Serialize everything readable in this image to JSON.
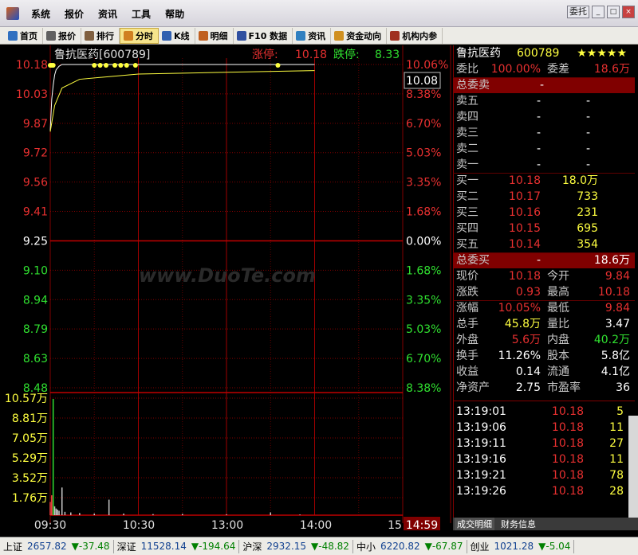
{
  "title_bar": {
    "menus": [
      "系统",
      "报价",
      "资讯",
      "工具",
      "帮助"
    ],
    "commission_btn": "委托",
    "min_btn": "_",
    "max_btn": "□",
    "close_btn": "×"
  },
  "toolbar": {
    "items": [
      {
        "label": "首页",
        "icon": "home-icon",
        "color": "#3070c0"
      },
      {
        "label": "报价",
        "icon": "quote-table-icon",
        "color": "#606060"
      },
      {
        "label": "排行",
        "icon": "rank-icon",
        "color": "#806040"
      },
      {
        "label": "分时",
        "icon": "timeshare-icon",
        "color": "#d08020",
        "active": true
      },
      {
        "label": "K线",
        "icon": "kline-icon",
        "color": "#3060b0"
      },
      {
        "label": "明细",
        "icon": "detail-icon",
        "color": "#c06020"
      },
      {
        "label": "F10 数据",
        "icon": "f10-icon",
        "color": "#3050a0"
      },
      {
        "label": "资讯",
        "icon": "news-icon",
        "color": "#3080c0"
      },
      {
        "label": "资金动向",
        "icon": "money-flow-icon",
        "color": "#d09020"
      },
      {
        "label": "机构内参",
        "icon": "institution-icon",
        "color": "#a03020"
      }
    ]
  },
  "chart_header": {
    "stock": "鲁抗医药[600789]",
    "limit_up_label": "涨停:",
    "limit_up": "10.18",
    "limit_down_label": "跌停:",
    "limit_down": "8.33",
    "watermark": "www.DuoTe.com"
  },
  "price_axis": {
    "left": [
      "10.18",
      "10.03",
      "9.87",
      "9.72",
      "9.56",
      "9.41",
      "9.25",
      "9.10",
      "8.94",
      "8.79",
      "8.63",
      "8.48"
    ],
    "right": [
      "10.06%",
      "8.38%",
      "6.70%",
      "5.03%",
      "3.35%",
      "1.68%",
      "0.00%",
      "1.68%",
      "3.35%",
      "5.03%",
      "6.70%",
      "8.38%"
    ],
    "current_price_tag": "10.08"
  },
  "volume_axis": [
    "10.57万",
    "8.81万",
    "7.05万",
    "5.29万",
    "3.52万",
    "1.76万"
  ],
  "time_axis": {
    "ticks": [
      "09:30",
      "10:30",
      "13:00",
      "14:00",
      "15"
    ],
    "current_time": "14:59"
  },
  "chart_data": {
    "type": "line",
    "title": "鲁抗医药[600789]",
    "price_ylim": [
      8.33,
      10.18
    ],
    "prev_close": 9.25,
    "price_series": [
      {
        "t": 0,
        "v": 9.8
      },
      {
        "t": 1,
        "v": 9.98
      },
      {
        "t": 2,
        "v": 10.06
      },
      {
        "t": 3,
        "v": 10.12
      },
      {
        "t": 4,
        "v": 10.15
      },
      {
        "t": 5,
        "v": 10.16
      },
      {
        "t": 6,
        "v": 10.17
      },
      {
        "t": 8,
        "v": 10.18
      },
      {
        "t": 12,
        "v": 10.18
      },
      {
        "t": 20,
        "v": 10.18
      },
      {
        "t": 30,
        "v": 10.18
      },
      {
        "t": 60,
        "v": 10.18
      },
      {
        "t": 90,
        "v": 10.18
      },
      {
        "t": 120,
        "v": 10.18
      },
      {
        "t": 150,
        "v": 10.18
      },
      {
        "t": 180,
        "v": 10.18
      }
    ],
    "avg_series": [
      {
        "t": 0,
        "v": 9.8
      },
      {
        "t": 3,
        "v": 9.95
      },
      {
        "t": 8,
        "v": 10.05
      },
      {
        "t": 20,
        "v": 10.1
      },
      {
        "t": 60,
        "v": 10.13
      },
      {
        "t": 120,
        "v": 10.14
      },
      {
        "t": 180,
        "v": 10.15
      }
    ],
    "volume_ylim": [
      0,
      105700
    ],
    "volume": [
      {
        "t": 0,
        "v": 12000
      },
      {
        "t": 1,
        "v": 18000
      },
      {
        "t": 2,
        "v": 105000
      },
      {
        "t": 3,
        "v": 8000
      },
      {
        "t": 4,
        "v": 6000
      },
      {
        "t": 5,
        "v": 5000
      },
      {
        "t": 6,
        "v": 4000
      },
      {
        "t": 8,
        "v": 25000
      },
      {
        "t": 10,
        "v": 3000
      },
      {
        "t": 14,
        "v": 2500
      },
      {
        "t": 20,
        "v": 2000
      },
      {
        "t": 30,
        "v": 1500
      },
      {
        "t": 40,
        "v": 14000
      },
      {
        "t": 50,
        "v": 1500
      },
      {
        "t": 70,
        "v": 1000
      },
      {
        "t": 90,
        "v": 1200
      },
      {
        "t": 120,
        "v": 800
      },
      {
        "t": 150,
        "v": 2500
      },
      {
        "t": 170,
        "v": 600
      }
    ],
    "markers_t": [
      0,
      1,
      2,
      30,
      34,
      38,
      44,
      48,
      52,
      58,
      155
    ],
    "session_minutes": 240,
    "grid": true
  },
  "quote_panel": {
    "name": "鲁抗医药",
    "code": "600789",
    "stars": "★★★★★",
    "wei_bi_label": "委比",
    "wei_bi": "100.00%",
    "wei_cha_label": "委差",
    "wei_cha": "18.6万",
    "total_sell_label": "总委卖",
    "total_sell": "-",
    "sells": [
      {
        "label": "卖五",
        "price": "-",
        "vol": "-"
      },
      {
        "label": "卖四",
        "price": "-",
        "vol": "-"
      },
      {
        "label": "卖三",
        "price": "-",
        "vol": "-"
      },
      {
        "label": "卖二",
        "price": "-",
        "vol": "-"
      },
      {
        "label": "卖一",
        "price": "-",
        "vol": "-"
      }
    ],
    "buys": [
      {
        "label": "买一",
        "price": "10.18",
        "vol": "18.0万"
      },
      {
        "label": "买二",
        "price": "10.17",
        "vol": "733"
      },
      {
        "label": "买三",
        "price": "10.16",
        "vol": "231"
      },
      {
        "label": "买四",
        "price": "10.15",
        "vol": "695"
      },
      {
        "label": "买五",
        "price": "10.14",
        "vol": "354"
      }
    ],
    "total_buy_label": "总委买",
    "total_buy_dash": "-",
    "total_buy": "18.6万",
    "stats": [
      {
        "l1": "现价",
        "v1": "10.18",
        "l2": "今开",
        "v2": "9.84"
      },
      {
        "l1": "涨跌",
        "v1": "0.93",
        "l2": "最高",
        "v2": "10.18"
      },
      {
        "l1": "涨幅",
        "v1": "10.05%",
        "l2": "最低",
        "v2": "9.84"
      },
      {
        "l1": "总手",
        "v1": "45.8万",
        "l2": "量比",
        "v2": "3.47"
      },
      {
        "l1": "外盘",
        "v1": "5.6万",
        "l2": "内盘",
        "v2": "40.2万"
      }
    ],
    "fund": [
      {
        "l1": "换手",
        "v1": "11.26%",
        "l2": "股本",
        "v2": "5.8亿"
      },
      {
        "l1": "收益",
        "v1": "0.14",
        "l2": "流通",
        "v2": "4.1亿"
      },
      {
        "l1": "净资产",
        "v1": "2.75",
        "l2": "市盈率",
        "v2": "36"
      }
    ],
    "ticks": [
      {
        "time": "13:19:01",
        "price": "10.18",
        "vol": "5"
      },
      {
        "time": "13:19:06",
        "price": "10.18",
        "vol": "11"
      },
      {
        "time": "13:19:11",
        "price": "10.18",
        "vol": "27"
      },
      {
        "time": "13:19:16",
        "price": "10.18",
        "vol": "11"
      },
      {
        "time": "13:19:21",
        "price": "10.18",
        "vol": "78"
      },
      {
        "time": "13:19:26",
        "price": "10.18",
        "vol": "28"
      }
    ],
    "tabs": [
      "成交明细",
      "财务信息"
    ]
  },
  "status_bar": [
    {
      "name": "上证",
      "value": "2657.82",
      "change": "▼-37.48"
    },
    {
      "name": "深证",
      "value": "11528.14",
      "change": "▼-194.64"
    },
    {
      "name": "沪深",
      "value": "2932.15",
      "change": "▼-48.82"
    },
    {
      "name": "中小",
      "value": "6220.82",
      "change": "▼-67.87"
    },
    {
      "name": "创业",
      "value": "1021.28",
      "change": "▼-5.04"
    }
  ],
  "colors": {
    "up": "#e83030",
    "down": "#30e030",
    "flat": "#ffffff",
    "grid": "#800000",
    "price_line": "#ffffff",
    "avg_line": "#ffff40"
  }
}
